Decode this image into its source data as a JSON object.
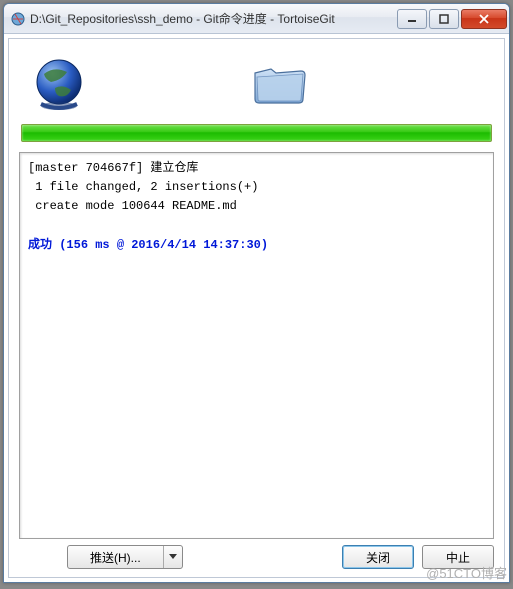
{
  "window": {
    "title": "D:\\Git_Repositories\\ssh_demo - Git命令进度 - TortoiseGit"
  },
  "icons": {
    "globe": "globe-icon",
    "folder": "folder-icon"
  },
  "progress": {
    "percent": 100
  },
  "output": {
    "line1": "[master 704667f] 建立仓库",
    "line2": " 1 file changed, 2 insertions(+)",
    "line3": " create mode 100644 README.md",
    "success_label": "成功",
    "success_detail": " (156 ms @ 2016/4/14 14:37:30)"
  },
  "buttons": {
    "push": "推送(H)...",
    "close": "关闭",
    "abort": "中止"
  },
  "watermark": "@51CTO博客"
}
